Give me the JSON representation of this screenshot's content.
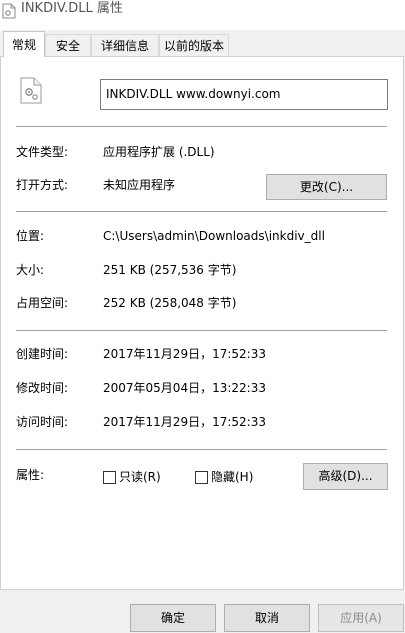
{
  "window": {
    "title": "INKDIV.DLL 属性"
  },
  "tabs": [
    {
      "label": "常规"
    },
    {
      "label": "安全"
    },
    {
      "label": "详细信息"
    },
    {
      "label": "以前的版本"
    }
  ],
  "general": {
    "file_name": "INKDIV.DLL      www.downyi.com",
    "file_type": {
      "label": "文件类型:",
      "value": "应用程序扩展 (.DLL)"
    },
    "open_with": {
      "label": "打开方式:",
      "value": "未知应用程序",
      "change_button": "更改(C)..."
    },
    "location": {
      "label": "位置:",
      "value": "C:\\Users\\admin\\Downloads\\inkdiv_dll"
    },
    "size": {
      "label": "大小:",
      "value": "251 KB (257,536 字节)"
    },
    "size_on_disk": {
      "label": "占用空间:",
      "value": "252 KB (258,048 字节)"
    },
    "created": {
      "label": "创建时间:",
      "value": "2017年11月29日，17:52:33"
    },
    "modified": {
      "label": "修改时间:",
      "value": "2007年05月04日，13:22:33"
    },
    "accessed": {
      "label": "访问时间:",
      "value": "2017年11月29日，17:52:33"
    },
    "attributes": {
      "label": "属性:",
      "readonly": {
        "label": "只读(R)",
        "checked": false
      },
      "hidden": {
        "label": "隐藏(H)",
        "checked": false
      },
      "advanced_button": "高级(D)..."
    }
  },
  "footer": {
    "ok": "确定",
    "cancel": "取消",
    "apply": "应用(A)"
  }
}
